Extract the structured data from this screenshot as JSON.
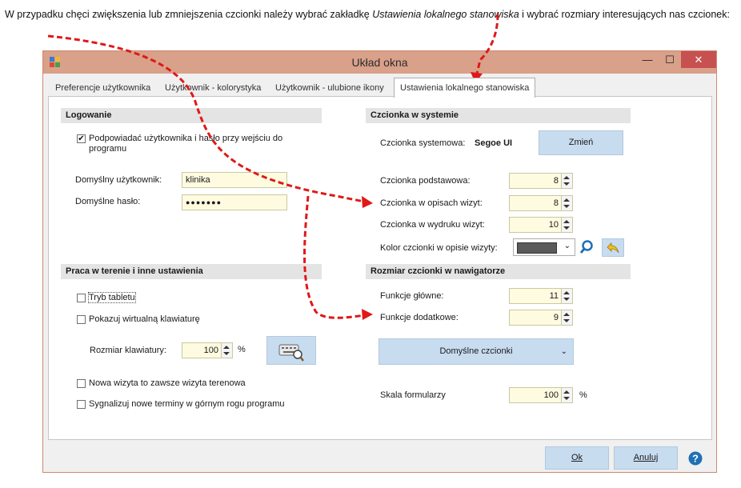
{
  "intro": {
    "before": "W przypadku chęci zwiększenia lub zmniejszenia czcionki należy wybrać zakładkę ",
    "italic": "Ustawienia lokalnego stanowiska",
    "after": " i wybrać rozmiary interesujących nas czcionek:"
  },
  "window": {
    "title": "Układ okna"
  },
  "tabs": [
    {
      "label": "Preferencje użytkownika"
    },
    {
      "label": "Użytkownik - kolorystyka"
    },
    {
      "label": "Użytkownik - ulubione ikony"
    },
    {
      "label": "Ustawienia lokalnego stanowiska",
      "active": true
    }
  ],
  "login": {
    "header": "Logowanie",
    "suggest_checkbox_label": "Podpowiadać użytkownika i hasło przy wejściu do programu",
    "suggest_checked": true,
    "default_user_label": "Domyślny użytkownik:",
    "default_user_value": "klinika",
    "default_password_label": "Domyślne hasło:",
    "default_password_value": "●●●●●●●"
  },
  "field": {
    "header": "Praca w terenie i inne ustawienia",
    "tablet_mode_label": "Tryb tabletu",
    "virtual_keyboard_label": "Pokazuj wirtualną klawiaturę",
    "keyboard_size_label": "Rozmiar klawiatury:",
    "keyboard_size_value": "100",
    "keyboard_size_unit": "%",
    "new_visit_label": "Nowa wizyta to zawsze wizyta terenowa",
    "signal_terms_label": "Sygnalizuj nowe terminy w górnym rogu programu"
  },
  "system_font": {
    "header": "Czcionka w systemie",
    "system_font_label": "Czcionka systemowa:",
    "system_font_value": "Segoe UI",
    "change_button": "Zmień",
    "base_font_label": "Czcionka podstawowa:",
    "base_font_value": "8",
    "visit_desc_font_label": "Czcionka w opisach wizyt:",
    "visit_desc_font_value": "8",
    "visit_print_font_label": "Czcionka w wydruku wizyt:",
    "visit_print_font_value": "10",
    "font_color_label": "Kolor czcionki w opisie wizyty:",
    "font_color_value": "#5a5a5a"
  },
  "navigator_font": {
    "header": "Rozmiar czcionki w nawigatorze",
    "main_functions_label": "Funkcje główne:",
    "main_functions_value": "11",
    "extra_functions_label": "Funkcje dodatkowe:",
    "extra_functions_value": "9",
    "default_fonts_button": "Domyślne czcionki",
    "form_scale_label": "Skala formularzy",
    "form_scale_value": "100",
    "form_scale_unit": "%"
  },
  "footer": {
    "ok_button": "Ok",
    "cancel_button": "Anuluj"
  },
  "colors": {
    "title_bar": "#d9a08a",
    "close_button": "#c75050",
    "button_fill": "#c8dcf0",
    "input_fill": "#fffbe0",
    "annotation_arrow": "#e01818"
  }
}
